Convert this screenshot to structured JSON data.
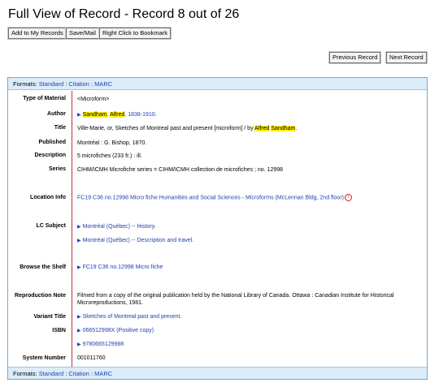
{
  "page_title": "Full View of Record - Record 8 out of 26",
  "toolbar": {
    "add_label": "Add to My Records",
    "save_label": "Save/Mail",
    "bookmark_label": "Right Click to Bookmark"
  },
  "nav": {
    "previous_label": "Previous Record",
    "next_label": "Next Record"
  },
  "formats": {
    "label": "Formats:",
    "standard": "Standard",
    "citation": "Citation",
    "marc": "MARC",
    "separator": ":"
  },
  "record": {
    "type_of_material": {
      "label": "Type of Material",
      "value": "<Microform>"
    },
    "author": {
      "label": "Author",
      "last": "Sandham",
      "first": "Alfred",
      "dates": "1838-1910."
    },
    "title": {
      "label": "Title",
      "text": "Ville-Marie, or, Sketches of Montreal past and present [microform] / by ",
      "hl_first": "Alfred",
      "hl_last": "Sandham",
      "end": "."
    },
    "published": {
      "label": "Published",
      "value": "Montréal : G. Bishop, 1870."
    },
    "description": {
      "label": "Description",
      "value": "5 microfiches (233 fr.) : ill."
    },
    "series": {
      "label": "Series",
      "value": "CIHM/ICMH Microfiche series = CIHM/ICMH collection de microfiches ; no. 12998"
    },
    "location": {
      "label": "Location Info",
      "value": "FC19 C36 no.12998 Micro fiche Humanities and Social Sciences - Microforms (McLennan Bldg, 2nd floor)",
      "icon_glyph": "i"
    },
    "lc_subject": {
      "label": "LC Subject",
      "items": [
        "Montréal (Québec) -- History.",
        "Montréal (Québec) -- Description and travel."
      ]
    },
    "browse_shelf": {
      "label": "Browse the Shelf",
      "value": "FC19 C36 no.12998 Micro fiche"
    },
    "reproduction_note": {
      "label": "Reproduction Note",
      "value": "Filmed from a copy of the original publication held by the National Library of Canada. Ottawa : Canadian Institute for Historical Microreproductions, 1981."
    },
    "variant_title": {
      "label": "Variant Title",
      "value": "Sketches of Montreal past and present."
    },
    "isbn": {
      "label": "ISBN",
      "items": [
        "066512998X (Positive copy)",
        "9780665129988"
      ]
    },
    "system_number": {
      "label": "System Number",
      "value": "001011760"
    }
  },
  "colors": {
    "link": "#1f3fb0",
    "highlight": "#ffef00",
    "divider": "#c2303a",
    "formats_bg": "#dcecf9",
    "border": "#6fa9d8"
  },
  "icons": {
    "arrow": "▶",
    "info": "info-circle-icon"
  }
}
